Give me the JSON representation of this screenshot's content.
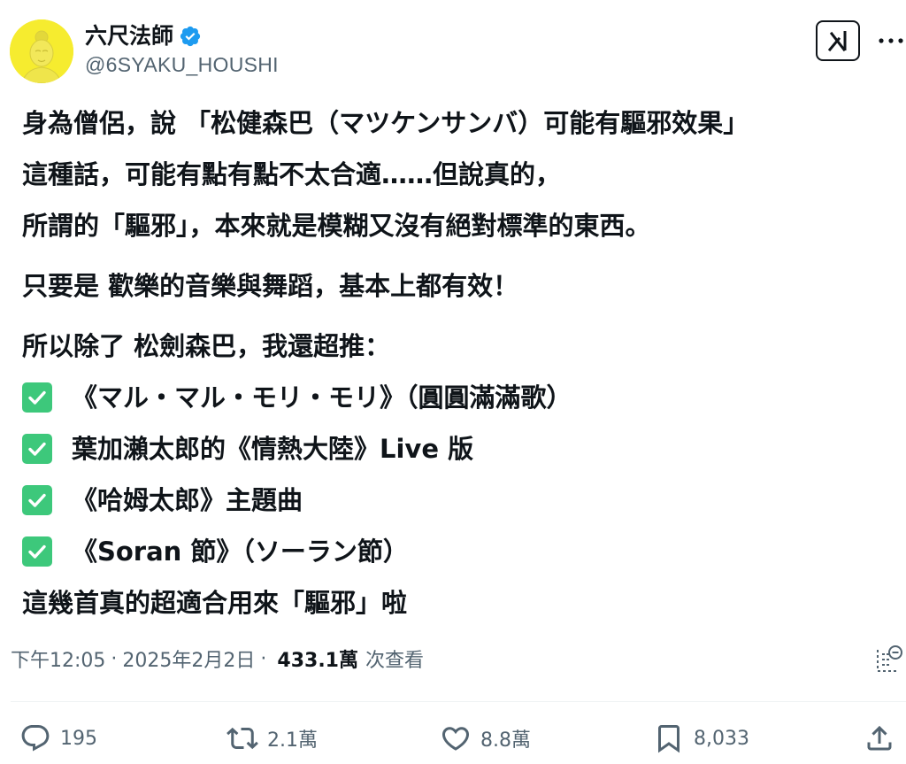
{
  "author": {
    "display_name": "六尺法師",
    "handle": "@6SYAKU_HOUSHI"
  },
  "tweet": {
    "lines": [
      "身為僧侶，說 「松健森巴（マツケンサンバ）可能有驅邪效果」",
      "這種話，可能有點有點不太合適……但說真的，",
      "所謂的「驅邪」，本來就是模糊又沒有絕對標準的東西。",
      "只要是 歡樂的音樂與舞蹈，基本上都有效！",
      "所以除了 松劍森巴，我還超推："
    ],
    "checklist": [
      "《マル・マル・モリ・モリ》（圓圓滿滿歌）",
      "葉加瀨太郎的《情熱大陸》Live 版",
      "《哈姆太郎》主題曲",
      "《Soran 節》（ソーラン節）"
    ],
    "closing": "這幾首真的超適合用來「驅邪」啦"
  },
  "meta": {
    "time": "下午12:05",
    "date": "2025年2月2日",
    "separator": "·",
    "views": "433.1萬",
    "views_label": "次查看"
  },
  "actions": {
    "reply_count": "195",
    "retweet_count": "2.1萬",
    "like_count": "8.8萬",
    "bookmark_count": "8,033"
  },
  "colors": {
    "accent_verified": "#1d9bf0",
    "checkbox_green": "#3dc87b",
    "avatar_yellow": "#f6ec2f",
    "secondary_text": "#536471"
  }
}
